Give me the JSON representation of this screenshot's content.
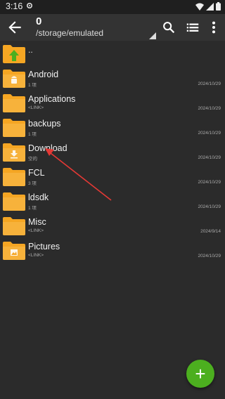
{
  "status": {
    "time": "3:16"
  },
  "toolbar": {
    "title": "0",
    "path": "/storage/emulated"
  },
  "parent": {
    "label": ".."
  },
  "items": [
    {
      "name": "Android",
      "sub": "1 项",
      "date": "2024/10/29",
      "emblem": "android-icon"
    },
    {
      "name": "Applications",
      "sub": "<LINK>",
      "date": "2024/10/29",
      "emblem": ""
    },
    {
      "name": "backups",
      "sub": "1 项",
      "date": "2024/10/29",
      "emblem": ""
    },
    {
      "name": "Download",
      "sub": "空的",
      "date": "2024/10/29",
      "emblem": "download-icon"
    },
    {
      "name": "FCL",
      "sub": "3 项",
      "date": "2024/10/29",
      "emblem": ""
    },
    {
      "name": "ldsdk",
      "sub": "1 项",
      "date": "2024/10/29",
      "emblem": ""
    },
    {
      "name": "Misc",
      "sub": "<LINK>",
      "date": "2024/9/14",
      "emblem": ""
    },
    {
      "name": "Pictures",
      "sub": "<LINK>",
      "date": "2024/10/29",
      "emblem": "image-icon"
    }
  ],
  "fab": {
    "label": "+"
  },
  "colors": {
    "folder": "#f5a623",
    "fab": "#4caf1f",
    "annotation": "#e53935"
  }
}
